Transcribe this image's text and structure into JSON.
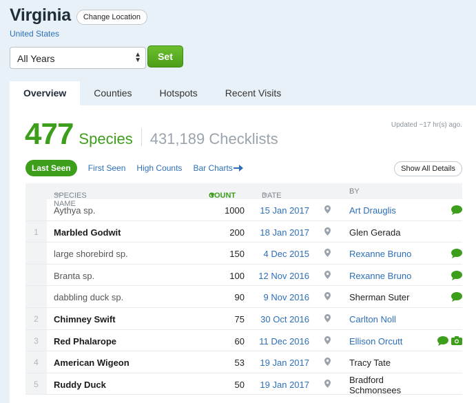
{
  "location": {
    "title": "Virginia",
    "change_label": "Change Location",
    "country": "United States"
  },
  "filter": {
    "selected_year": "All Years",
    "set_label": "Set"
  },
  "tabs": [
    {
      "label": "Overview",
      "active": true
    },
    {
      "label": "Counties",
      "active": false
    },
    {
      "label": "Hotspots",
      "active": false
    },
    {
      "label": "Recent Visits",
      "active": false
    }
  ],
  "summary": {
    "species_count": "477",
    "species_label": "Species",
    "checklists": "431,189 Checklists",
    "updated": "Updated ~17 hr(s) ago."
  },
  "sort": {
    "active": "Last Seen",
    "first_seen": "First Seen",
    "high_counts": "High Counts",
    "bar_charts": "Bar Charts",
    "show_all": "Show All Details"
  },
  "columns": {
    "species": "SPECIES NAME",
    "count": "COUNT",
    "date": "DATE",
    "by": "BY"
  },
  "colors": {
    "accent_green": "#3d9e1c",
    "link_blue": "#2d6fb8"
  },
  "rows": [
    {
      "num": "",
      "name": "Aythya sp.",
      "bold": false,
      "count": "1000",
      "date": "15 Jan 2017",
      "by": "Art Drauglis",
      "by_link": true,
      "comment": true,
      "photo": false
    },
    {
      "num": "1",
      "name": "Marbled Godwit",
      "bold": true,
      "count": "200",
      "date": "18 Jan 2017",
      "by": "Glen Gerada",
      "by_link": false,
      "comment": false,
      "photo": false
    },
    {
      "num": "",
      "name": "large shorebird sp.",
      "bold": false,
      "count": "150",
      "date": "4 Dec 2015",
      "by": "Rexanne Bruno",
      "by_link": true,
      "comment": true,
      "photo": false
    },
    {
      "num": "",
      "name": "Branta sp.",
      "bold": false,
      "count": "100",
      "date": "12 Nov 2016",
      "by": "Rexanne Bruno",
      "by_link": true,
      "comment": true,
      "photo": false
    },
    {
      "num": "",
      "name": "dabbling duck sp.",
      "bold": false,
      "count": "90",
      "date": "9 Nov 2016",
      "by": "Sherman Suter",
      "by_link": false,
      "comment": true,
      "photo": false
    },
    {
      "num": "2",
      "name": "Chimney Swift",
      "bold": true,
      "count": "75",
      "date": "30 Oct 2016",
      "by": "Carlton Noll",
      "by_link": true,
      "comment": false,
      "photo": false
    },
    {
      "num": "3",
      "name": "Red Phalarope",
      "bold": true,
      "count": "60",
      "date": "11 Dec 2016",
      "by": "Ellison Orcutt",
      "by_link": true,
      "comment": true,
      "photo": true
    },
    {
      "num": "4",
      "name": "American Wigeon",
      "bold": true,
      "count": "53",
      "date": "19 Jan 2017",
      "by": "Tracy Tate",
      "by_link": false,
      "comment": false,
      "photo": false
    },
    {
      "num": "5",
      "name": "Ruddy Duck",
      "bold": true,
      "count": "50",
      "date": "19 Jan 2017",
      "by": "Bradford Schmonsees",
      "by_link": false,
      "comment": false,
      "photo": false
    }
  ]
}
